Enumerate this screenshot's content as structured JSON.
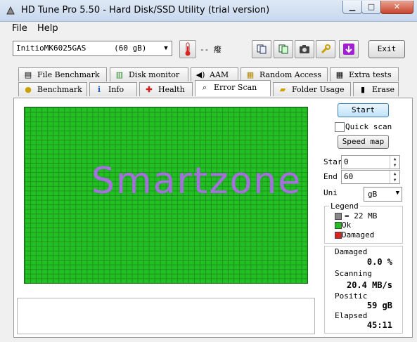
{
  "window": {
    "title": "HD Tune Pro 5.50 - Hard Disk/SSD Utility (trial version)"
  },
  "menu": {
    "file": "File",
    "help": "Help"
  },
  "toolbar": {
    "drive": "InitioMK6025GAS      (60 gB)",
    "temperature": "-- 癈",
    "exit_label": "Exit"
  },
  "tabs_row1": [
    {
      "label": "File Benchmark",
      "icon": "file-benchmark-icon"
    },
    {
      "label": "Disk monitor",
      "icon": "disk-monitor-icon"
    },
    {
      "label": "AAM",
      "icon": "speaker-icon"
    },
    {
      "label": "Random Access",
      "icon": "random-access-icon"
    },
    {
      "label": "Extra tests",
      "icon": "extra-tests-icon"
    }
  ],
  "tabs_row2": [
    {
      "label": "Benchmark",
      "icon": "lightbulb-icon"
    },
    {
      "label": "Info",
      "icon": "info-icon"
    },
    {
      "label": "Health",
      "icon": "health-cross-icon"
    },
    {
      "label": "Error Scan",
      "icon": "magnifier-icon",
      "active": true
    },
    {
      "label": "Folder Usage",
      "icon": "folder-icon"
    },
    {
      "label": "Erase",
      "icon": "trash-icon"
    }
  ],
  "scan": {
    "start_label": "Start",
    "quick_scan_label": "Quick scan",
    "quick_scan_checked": false,
    "speed_map_label": "Speed map",
    "start_field_label": "Star",
    "start_value": "0",
    "end_field_label": "End",
    "end_value": "60",
    "unit_label": "Uni",
    "unit_value": "gB",
    "grid_state": "ok",
    "grid_color": "#22c022"
  },
  "legend": {
    "title": "Legend",
    "block_size": "= 22 MB",
    "ok_label": "Ok",
    "damaged_label": "Damaged",
    "colors": {
      "block": "#888888",
      "ok": "#22c022",
      "damaged": "#e02020"
    }
  },
  "stats": {
    "damaged_label": "Damaged",
    "damaged_value": "0.0 %",
    "scanning_label": "Scanning",
    "scanning_value": "20.4 MB/s",
    "position_label": "Positic",
    "position_value": "59 gB",
    "elapsed_label": "Elapsed",
    "elapsed_value": "45:11"
  },
  "watermark": "Smartzone"
}
